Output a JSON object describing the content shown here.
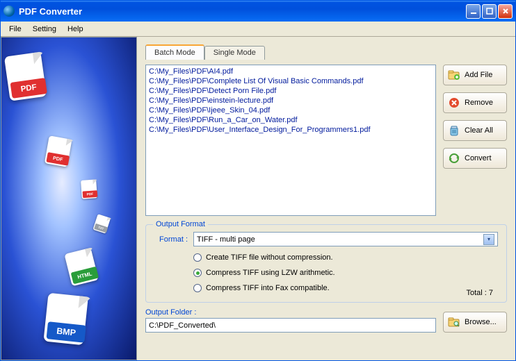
{
  "window": {
    "title": "PDF Converter"
  },
  "menu": {
    "file": "File",
    "setting": "Setting",
    "help": "Help"
  },
  "tabs": {
    "batch": "Batch Mode",
    "single": "Single Mode",
    "active": "batch"
  },
  "files": [
    "C:\\My_Files\\PDF\\AI4.pdf",
    "C:\\My_Files\\PDF\\Complete List Of Visual Basic Commands.pdf",
    "C:\\My_Files\\PDF\\Detect Porn File.pdf",
    "C:\\My_Files\\PDF\\einstein-lecture.pdf",
    "C:\\My_Files\\PDF\\Ijeee_Skin_04.pdf",
    "C:\\My_Files\\PDF\\Run_a_Car_on_Water.pdf",
    "C:\\My_Files\\PDF\\User_Interface_Design_For_Programmers1.pdf"
  ],
  "buttons": {
    "add": "Add File",
    "remove": "Remove",
    "clear": "Clear All",
    "convert": "Convert",
    "browse": "Browse..."
  },
  "output_format": {
    "legend": "Output Format",
    "format_label": "Format :",
    "selected": "TIFF - multi page",
    "options": {
      "none": "Create TIFF file without compression.",
      "lzw": "Compress TIFF using LZW arithmetic.",
      "fax": "Compress TIFF into Fax compatible."
    },
    "selected_option": "lzw"
  },
  "status": {
    "total_label": "Total :",
    "total_count": "7"
  },
  "output_folder": {
    "label": "Output Folder :",
    "path": "C:\\PDF_Converted\\"
  },
  "sidebar_badges": [
    {
      "label": "PDF",
      "color": "#e03030"
    },
    {
      "label": "PDF",
      "color": "#e03030"
    },
    {
      "label": "PDF",
      "color": "#e03030"
    },
    {
      "label": "TXT",
      "color": "#9aa0a6"
    },
    {
      "label": "HTML",
      "color": "#2a9d3a"
    },
    {
      "label": "BMP",
      "color": "#1559c8"
    }
  ]
}
